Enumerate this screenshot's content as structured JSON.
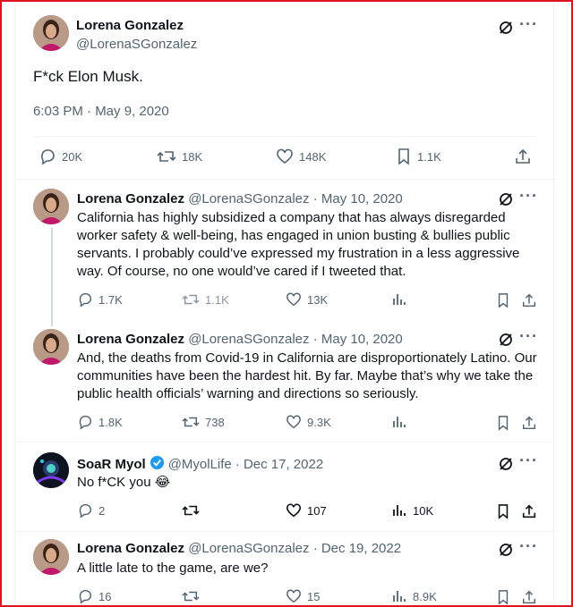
{
  "main_tweet": {
    "name": "Lorena Gonzalez",
    "handle": "@LorenaSGonzalez",
    "text": "F*ck Elon Musk.",
    "timestamp": "6:03 PM · May 9, 2020",
    "stats": {
      "replies": "20K",
      "retweets": "18K",
      "likes": "148K",
      "bookmarks": "1.1K"
    }
  },
  "replies": [
    {
      "name": "Lorena Gonzalez",
      "handle": "@LorenaSGonzalez",
      "date": "· May 10, 2020",
      "text": "California has highly subsidized a company that has always disregarded worker safety & well-being, has engaged in union busting & bullies public servants. I probably could’ve expressed my frustration in a less aggressive way. Of course, no one would’ve cared if I tweeted that.",
      "stats": {
        "replies": "1.7K",
        "retweets": "1.1K",
        "likes": "13K",
        "views": ""
      }
    },
    {
      "name": "Lorena Gonzalez",
      "handle": "@LorenaSGonzalez",
      "date": "· May 10, 2020",
      "text": "And, the deaths from Covid-19 in California are disproportionately Latino. Our communities have been the hardest hit. By far. Maybe that’s why we take the public health officials’ warning and directions so seriously.",
      "stats": {
        "replies": "1.8K",
        "retweets": "738",
        "likes": "9.3K",
        "views": ""
      }
    },
    {
      "name": "SoaR Myol",
      "handle": "@MyolLife",
      "date": "· Dec 17, 2022",
      "text": "No f*CK you 😂",
      "stats": {
        "replies": "2",
        "retweets": "",
        "likes": "107",
        "views": "10K"
      }
    },
    {
      "name": "Lorena Gonzalez",
      "handle": "@LorenaSGonzalez",
      "date": "· Dec 19, 2022",
      "text": "A little late to the game, are we?",
      "stats": {
        "replies": "16",
        "retweets": "",
        "likes": "15",
        "views": "8.9K"
      }
    }
  ],
  "more_label": "···",
  "colors": {
    "accent": "#1d9bf0",
    "muted": "#536471",
    "border": "#e0141e"
  }
}
